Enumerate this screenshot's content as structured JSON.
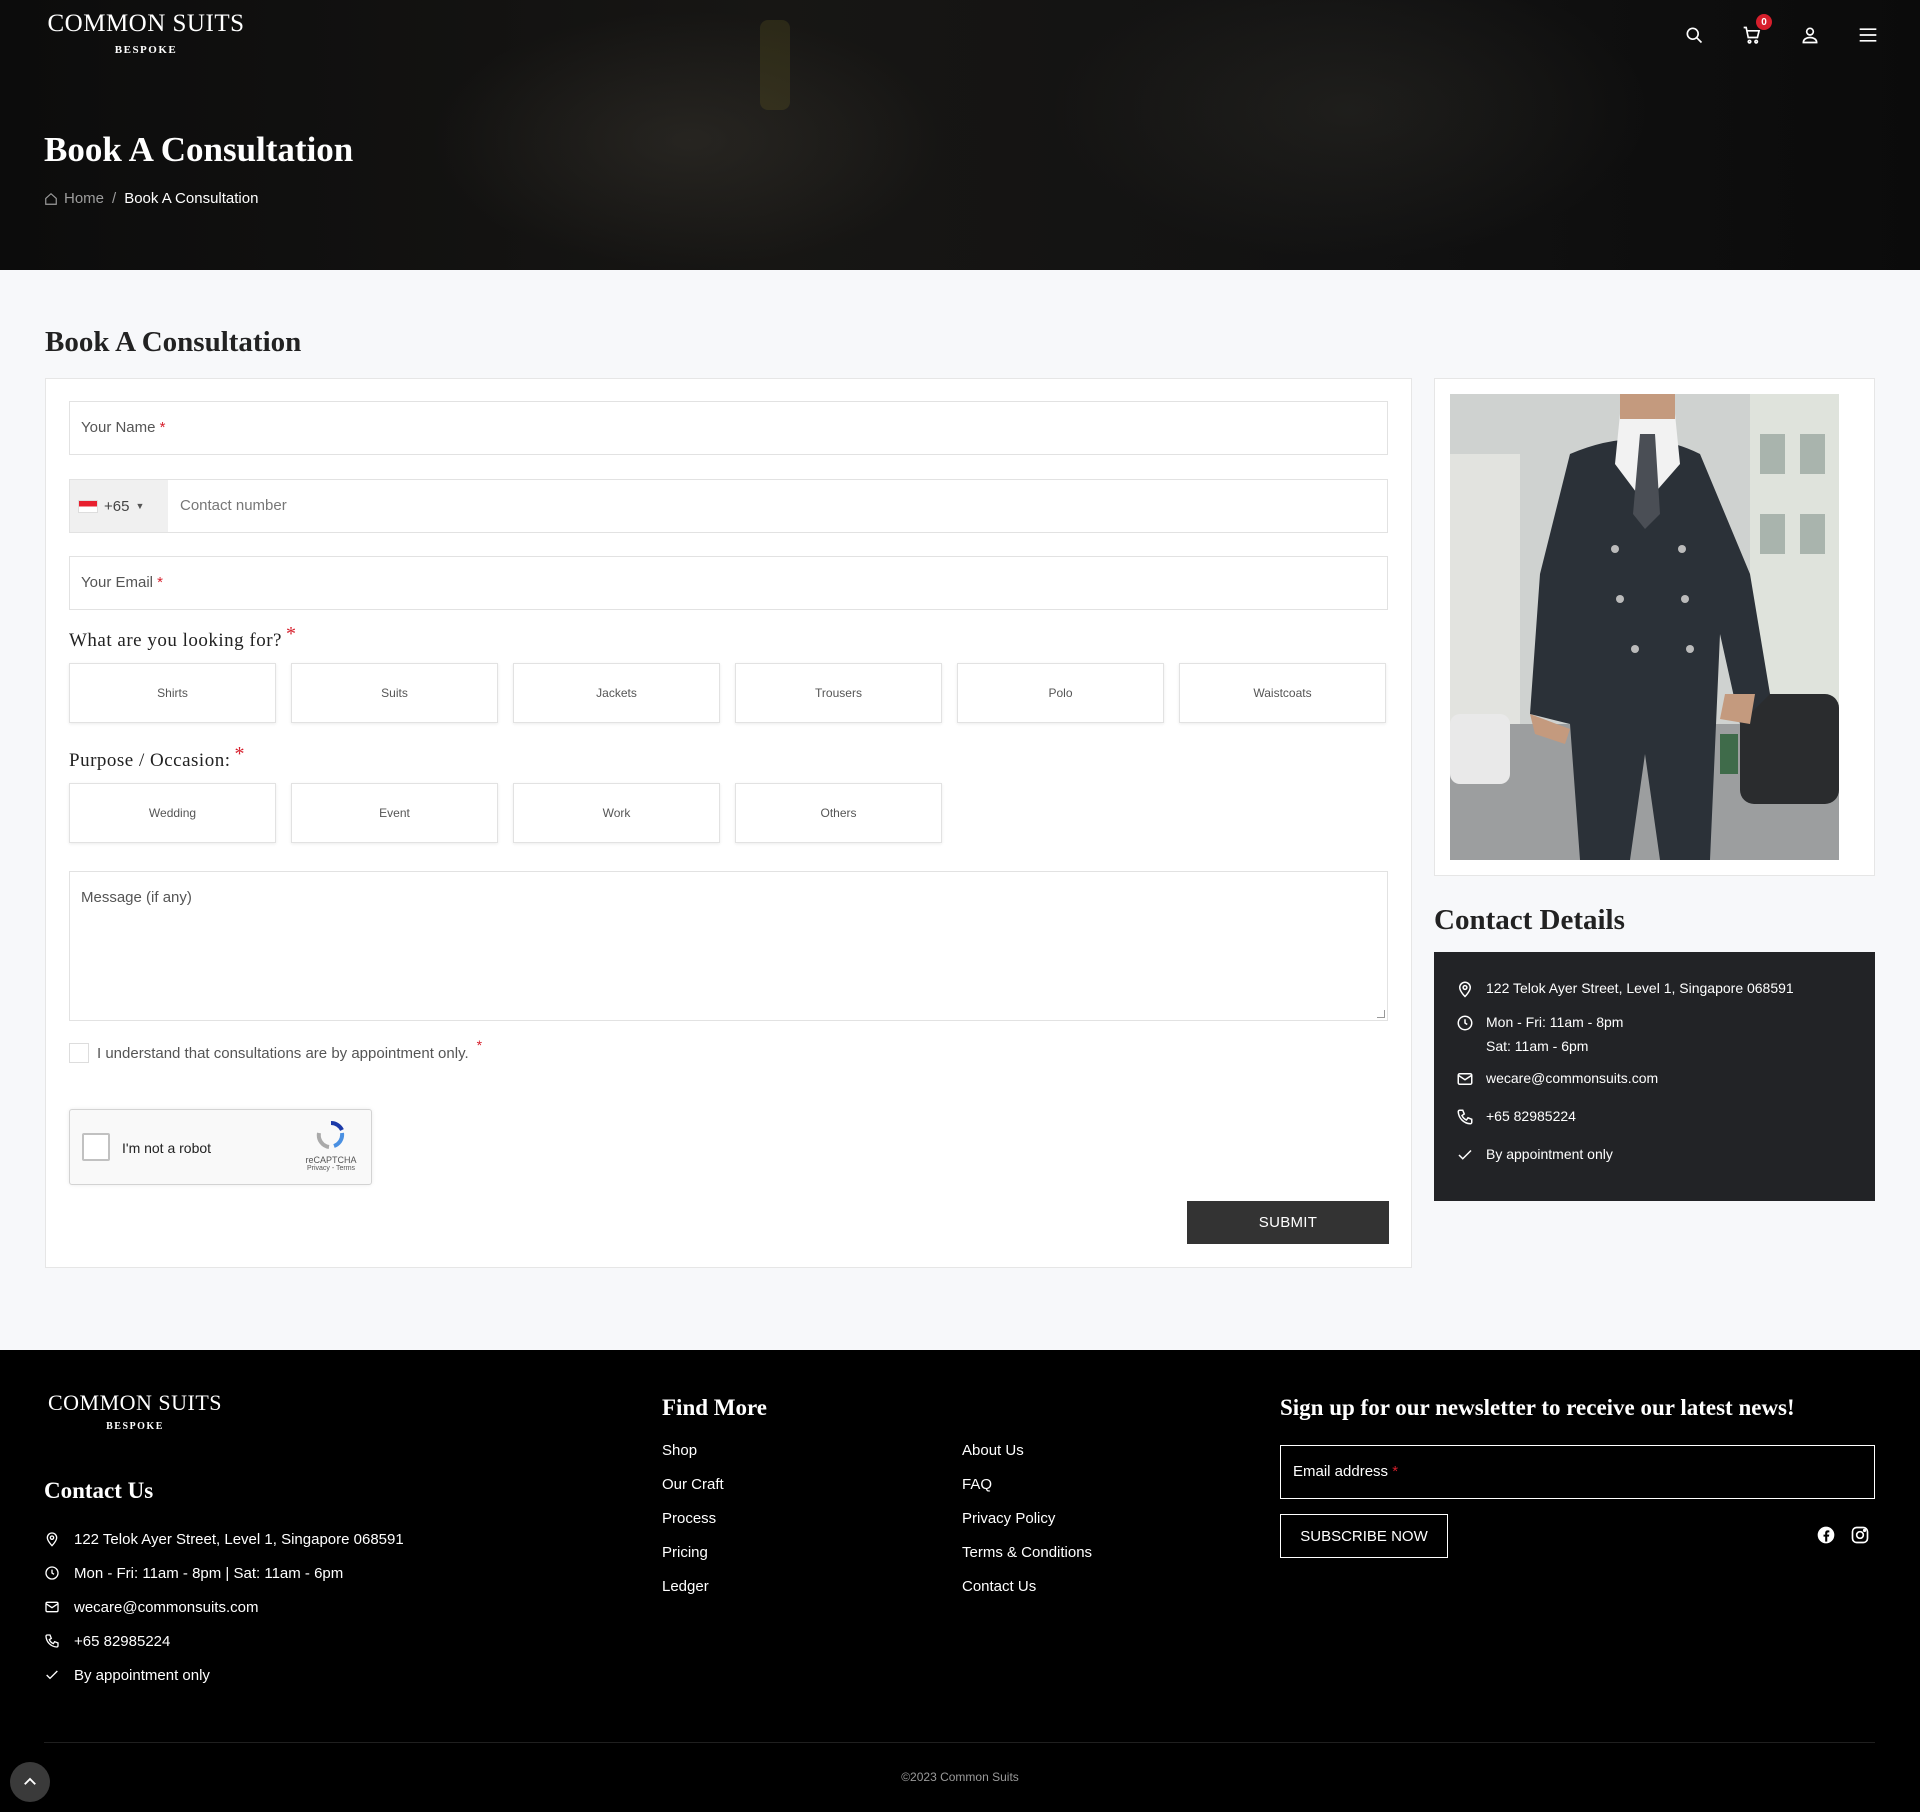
{
  "brand": {
    "name": "COMMON SUITS",
    "tagline": "BESPOKE"
  },
  "header": {
    "icons": [
      "search-icon",
      "cart-icon",
      "user-icon",
      "menu-icon"
    ],
    "cart_count": "0"
  },
  "hero": {
    "title": "Book A Consultation",
    "breadcrumb": {
      "home": "Home",
      "separator": "/",
      "current": "Book A Consultation"
    }
  },
  "form": {
    "title": "Book A Consultation",
    "name_label": "Your Name",
    "required_mark": "*",
    "phone": {
      "country_code": "+65",
      "placeholder": "Contact number"
    },
    "email_label": "Your Email",
    "looking_for": {
      "label": "What are you looking for?",
      "options": [
        "Shirts",
        "Suits",
        "Jackets",
        "Trousers",
        "Polo",
        "Waistcoats"
      ]
    },
    "purpose": {
      "label": "Purpose / Occasion:",
      "options": [
        "Wedding",
        "Event",
        "Work",
        "Others"
      ]
    },
    "message_placeholder": "Message (if any)",
    "consent_text": "I understand that consultations are by appointment only.",
    "captcha": {
      "label": "I'm not a robot",
      "brand": "reCAPTCHA",
      "terms": "Privacy - Terms"
    },
    "submit_label": "SUBMIT"
  },
  "contact_details": {
    "title": "Contact Details",
    "address": "122 Telok Ayer Street, Level 1, Singapore 068591",
    "hours_line1": "Mon - Fri: 11am - 8pm",
    "hours_line2": "Sat: 11am - 6pm",
    "email": "wecare@commonsuits.com",
    "phone": "+65 82985224",
    "note": "By appointment only"
  },
  "footer": {
    "contact_title": "Contact Us",
    "contact": {
      "address": "122 Telok Ayer Street, Level 1, Singapore 068591",
      "hours": "Mon - Fri: 11am - 8pm | Sat: 11am - 6pm",
      "email": "wecare@commonsuits.com",
      "phone": "+65 82985224",
      "note": "By appointment only"
    },
    "find_more_title": "Find More",
    "links_col1": [
      "Shop",
      "Our Craft",
      "Process",
      "Pricing",
      "Ledger"
    ],
    "links_col2": [
      "About Us",
      "FAQ",
      "Privacy Policy",
      "Terms & Conditions",
      "Contact Us"
    ],
    "newsletter_title": "Sign up for our newsletter to receive our latest news!",
    "newsletter_placeholder": "Email address",
    "subscribe_label": "SUBSCRIBE NOW",
    "social_icons": [
      "facebook-icon",
      "instagram-icon"
    ],
    "copyright": "©2023 Common Suits"
  },
  "colors": {
    "accent_required": "#d61f2c",
    "dark_panel": "#222326",
    "submit_bg": "#333333",
    "footer_bg": "#000000"
  }
}
